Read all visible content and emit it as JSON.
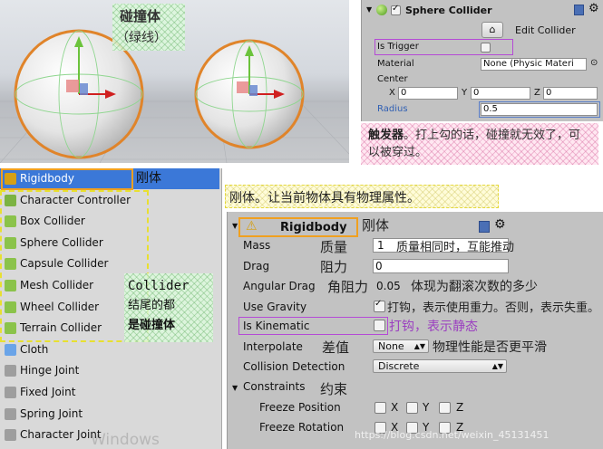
{
  "scene": {
    "caption_title": "碰撞体",
    "caption_sub": "（绿线）"
  },
  "sphere_collider": {
    "title": "Sphere Collider",
    "edit_collider": "Edit Collider",
    "is_trigger": {
      "label": "Is Trigger",
      "checked": false
    },
    "material": {
      "label": "Material",
      "value": "None (Physic Materi"
    },
    "center": {
      "label": "Center",
      "x": "0",
      "y": "0",
      "z": "0"
    },
    "radius": {
      "label": "Radius",
      "value": "0.5"
    },
    "axis_labels": {
      "x": "X",
      "y": "Y",
      "z": "Z"
    },
    "note": {
      "bold": "触发器",
      "text": "。打上勾的话，碰撞就无效了，可以被穿过。"
    }
  },
  "component_list": {
    "items": [
      {
        "label": "Rigidbody",
        "icon_color": "#d4a017",
        "selected": true
      },
      {
        "label": "Character Controller",
        "icon_color": "#7cb342"
      },
      {
        "label": "Box Collider",
        "icon_color": "#8bc34a"
      },
      {
        "label": "Sphere Collider",
        "icon_color": "#8bc34a"
      },
      {
        "label": "Capsule Collider",
        "icon_color": "#8bc34a"
      },
      {
        "label": "Mesh Collider",
        "icon_color": "#8bc34a"
      },
      {
        "label": "Wheel Collider",
        "icon_color": "#8bc34a"
      },
      {
        "label": "Terrain Collider",
        "icon_color": "#8bc34a"
      },
      {
        "label": "Cloth",
        "icon_color": "#6aa4e8"
      },
      {
        "label": "Hinge Joint",
        "icon_color": "#9e9e9e"
      },
      {
        "label": "Fixed Joint",
        "icon_color": "#9e9e9e"
      },
      {
        "label": "Spring Joint",
        "icon_color": "#9e9e9e"
      },
      {
        "label": "Character Joint",
        "icon_color": "#9e9e9e"
      }
    ],
    "rigidbody_note": "刚体",
    "collider_note_1": "Collider",
    "collider_note_2": "结尾的都",
    "collider_note_3": "是碰撞体",
    "watermark": "Windows"
  },
  "rigidbody": {
    "header_note": "刚体。让当前物体具有物理属性。",
    "title": "Rigidbody",
    "title_note": "刚体",
    "mass": {
      "label": "Mass",
      "note": "质量",
      "value": "1",
      "value_note": "质量相同时，互能推动"
    },
    "drag": {
      "label": "Drag",
      "note": "阻力",
      "value": "0"
    },
    "angular_drag": {
      "label": "Angular Drag",
      "note": "角阻力",
      "value": "0.05",
      "value_note": "体现为翻滚次数的多少"
    },
    "use_gravity": {
      "label": "Use Gravity",
      "checked": true,
      "note": "打钩，表示使用重力。否则，表示失重。"
    },
    "is_kinematic": {
      "label": "Is Kinematic",
      "checked": false,
      "note": "打钩，表示静态"
    },
    "interpolate": {
      "label": "Interpolate",
      "note": "差值",
      "value": "None",
      "value_note": "物理性能是否更平滑"
    },
    "collision_detection": {
      "label": "Collision Detection",
      "value": "Discrete"
    },
    "constraints": {
      "label": "Constraints",
      "note": "约束"
    },
    "freeze_position": {
      "label": "Freeze Position"
    },
    "freeze_rotation": {
      "label": "Freeze Rotation"
    },
    "axis_labels": {
      "x": "X",
      "y": "Y",
      "z": "Z"
    },
    "watermark": "https://blog.csdn.net/weixin_45131451"
  },
  "colors": {
    "selection_blue": "#3b78d8",
    "orange_highlight": "#f0a020",
    "purple_highlight": "#b44ad6",
    "blue_highlight": "#5a7ec8",
    "inspector_gray": "#c2c2c2"
  }
}
